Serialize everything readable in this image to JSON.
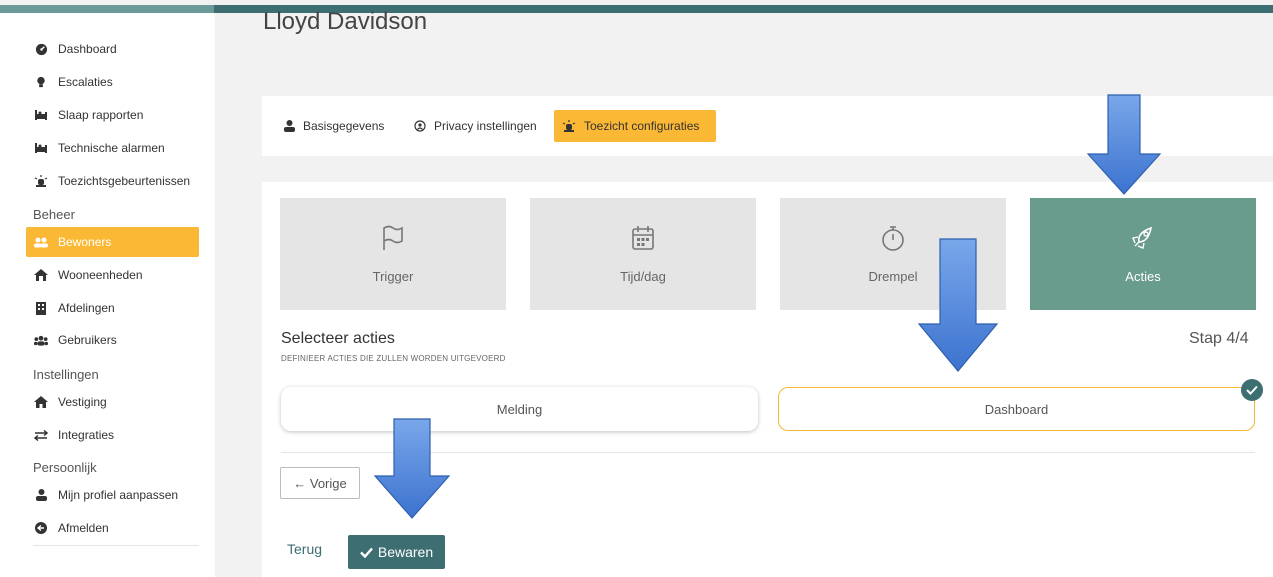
{
  "header": {
    "title": "Lloyd Davidson"
  },
  "sidebar": {
    "items": [
      {
        "label": "Dashboard",
        "icon": "gauge-icon"
      },
      {
        "label": "Escalaties",
        "icon": "lightbulb-icon"
      },
      {
        "label": "Slaap rapporten",
        "icon": "bed-icon"
      },
      {
        "label": "Technische alarmen",
        "icon": "bed-icon"
      },
      {
        "label": "Toezichtsgebeurtenissen",
        "icon": "siren-icon"
      }
    ],
    "sections": {
      "beheer": "Beheer",
      "instellingen": "Instellingen",
      "persoonlijk": "Persoonlijk"
    },
    "beheer_items": [
      {
        "label": "Bewoners",
        "icon": "users-icon",
        "active": true
      },
      {
        "label": "Wooneenheden",
        "icon": "home-icon"
      },
      {
        "label": "Afdelingen",
        "icon": "building-icon"
      },
      {
        "label": "Gebruikers",
        "icon": "user-group-icon"
      }
    ],
    "instellingen_items": [
      {
        "label": "Vestiging",
        "icon": "house-icon"
      },
      {
        "label": "Integraties",
        "icon": "exchange-icon"
      }
    ],
    "persoonlijk_items": [
      {
        "label": "Mijn profiel aanpassen",
        "icon": "user-icon"
      },
      {
        "label": "Afmelden",
        "icon": "logout-icon"
      }
    ]
  },
  "tabs": [
    {
      "label": "Basisgegevens",
      "icon": "user-icon"
    },
    {
      "label": "Privacy instellingen",
      "icon": "privacy-icon"
    },
    {
      "label": "Toezicht configuraties",
      "icon": "siren-icon",
      "active": true
    }
  ],
  "steps": [
    {
      "label": "Trigger",
      "icon": "flag-icon"
    },
    {
      "label": "Tijd/dag",
      "icon": "calendar-icon"
    },
    {
      "label": "Drempel",
      "icon": "stopwatch-icon"
    },
    {
      "label": "Acties",
      "icon": "rocket-icon",
      "active": true
    }
  ],
  "selection": {
    "title": "Selecteer acties",
    "subtitle": "DEFINIEER ACTIES DIE ZULLEN WORDEN UITGEVOERD",
    "step_count": "Stap 4/4",
    "options": [
      {
        "label": "Melding",
        "selected": false
      },
      {
        "label": "Dashboard",
        "selected": true
      }
    ]
  },
  "buttons": {
    "prev": "← Vorige",
    "back": "Terug",
    "save": "Bewaren"
  },
  "colors": {
    "accent": "#fbb834",
    "primary": "#3c6e72",
    "step_active": "#6a9c8d",
    "arrow": "#4a80d6"
  }
}
